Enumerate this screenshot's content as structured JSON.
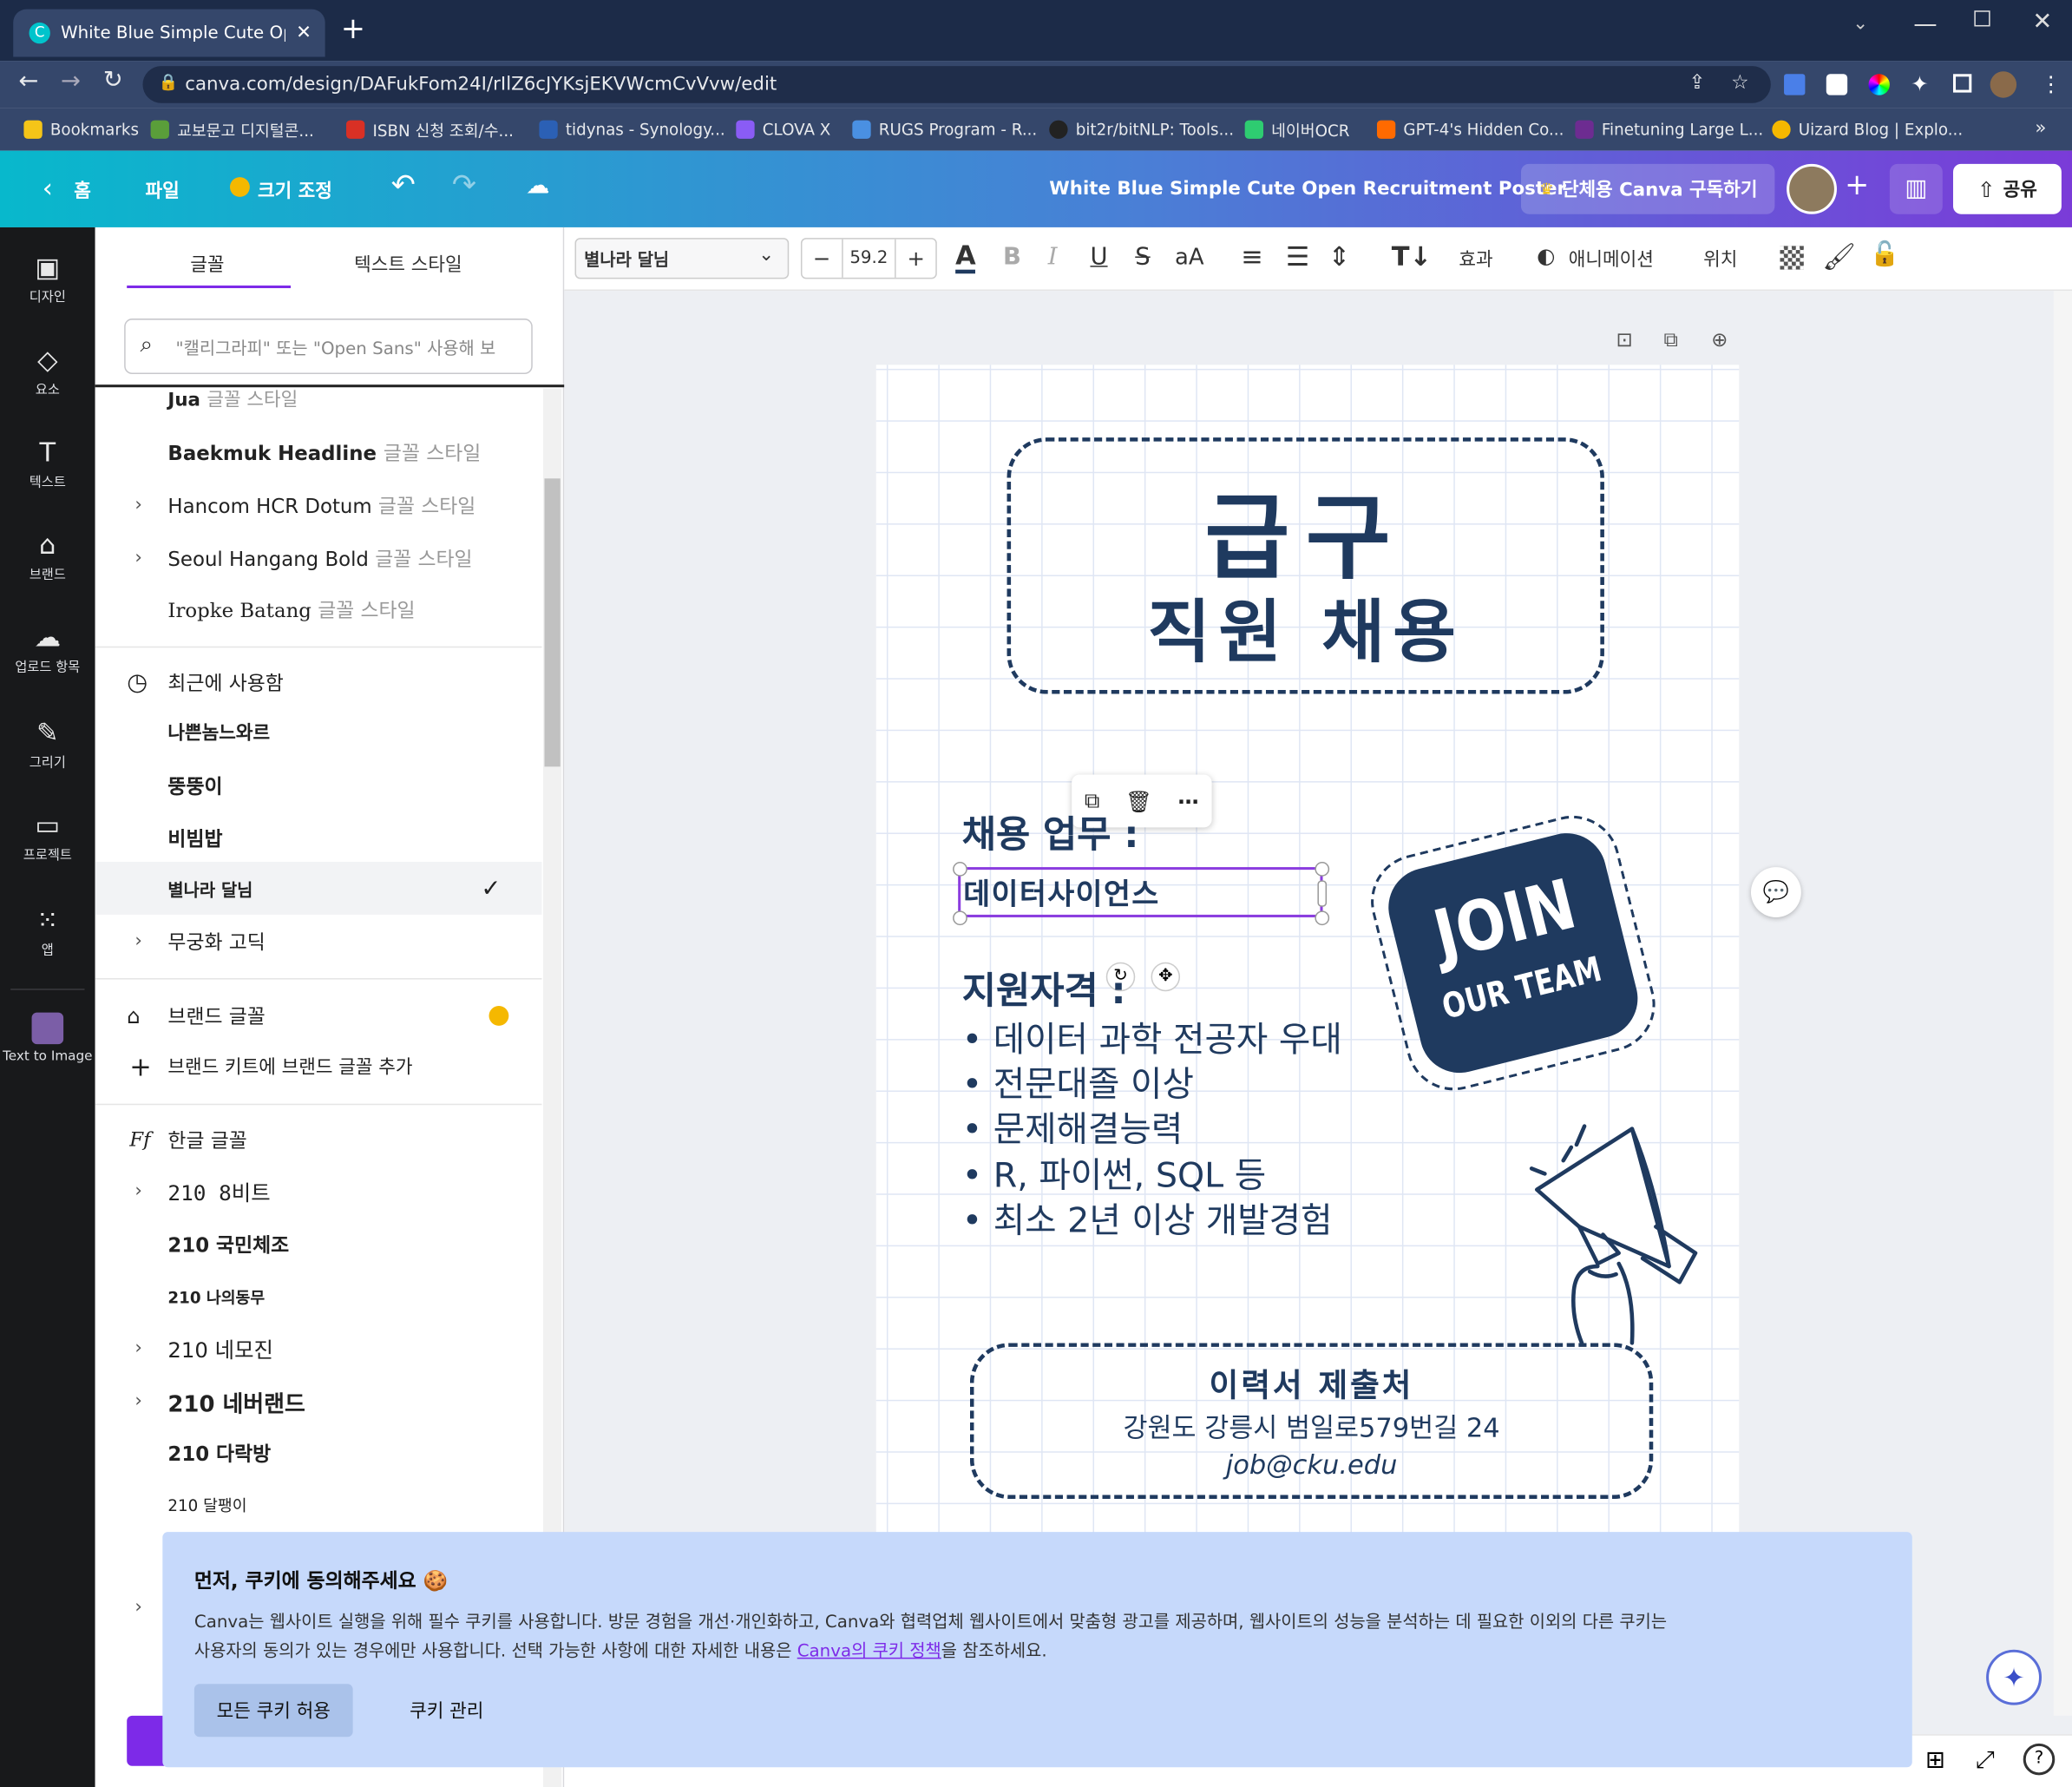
{
  "browser": {
    "tab_title": "White Blue Simple Cute Open R",
    "url": "canva.com/design/DAFukFom24I/rIlZ6cJYKsjEKVWcmCvVvw/edit",
    "bookmarks": [
      {
        "label": "Bookmarks",
        "color": "#f5c518"
      },
      {
        "label": "교보문고 디지털콘...",
        "color": "#5a9e3a"
      },
      {
        "label": "ISBN 신청 조회/수...",
        "color": "#d93025"
      },
      {
        "label": "tidynas - Synology...",
        "color": "#2b60b5"
      },
      {
        "label": "CLOVA X",
        "color": "#8a5cf5"
      },
      {
        "label": "RUGS Program - R...",
        "color": "#4a90e2"
      },
      {
        "label": "bit2r/bitNLP: Tools...",
        "color": "#222222"
      },
      {
        "label": "네이버OCR",
        "color": "#2ecc71"
      },
      {
        "label": "GPT-4's Hidden Co...",
        "color": "#ff6a00"
      },
      {
        "label": "Finetuning Large L...",
        "color": "#6d2c91"
      },
      {
        "label": "Uizard Blog | Explo...",
        "color": "#f5b800"
      }
    ]
  },
  "header": {
    "back": "홈",
    "file": "파일",
    "resize": "크기 조정",
    "title": "White Blue Simple Cute Open Recruitment Poster",
    "subscribe": "단체용 Canva 구독하기",
    "share": "공유"
  },
  "rail": [
    "디자인",
    "요소",
    "텍스트",
    "브랜드",
    "업로드 항목",
    "그리기",
    "프로젝트",
    "앱",
    "Text to Image"
  ],
  "panel": {
    "tab_font": "글꼴",
    "tab_style": "텍스트 스타일",
    "search_placeholder": "\"캘리그라피\" 또는 \"Open Sans\" 사용해 보",
    "top_fonts": [
      {
        "name": "Jua",
        "sub": "글꼴 스타일"
      },
      {
        "name": "Baekmuk Headline",
        "sub": "글꼴 스타일"
      },
      {
        "name": "Hancom HCR Dotum",
        "sub": "글꼴 스타일"
      },
      {
        "name": "Seoul Hangang Bold",
        "sub": "글꼴 스타일"
      },
      {
        "name": "Iropke Batang",
        "sub": "글꼴 스타일"
      }
    ],
    "recent_title": "최근에 사용함",
    "recent": [
      "나쁜놈느와르",
      "뚱뚱이",
      "비빔밥",
      "별나라 달님",
      "무궁화 고딕"
    ],
    "brand_title": "브랜드 글꼴",
    "brand_add": "브랜드 키트에 브랜드 글꼴 추가",
    "korean_title": "한글 글꼴",
    "korean": [
      "210 8비트",
      "210 국민체조",
      "210 나의동무",
      "210 네모진",
      "210 네버랜드",
      "210 다락방",
      "210 달팽이"
    ]
  },
  "toolbar": {
    "font": "별나라 달님",
    "size": "59.2",
    "effects": "효과",
    "animate": "애니메이션",
    "position": "위치"
  },
  "poster": {
    "title1": "급구",
    "title2": "직원 채용",
    "job_label": "채용 업무 :",
    "job_value": "데이터사이언스",
    "qual_label": "지원자격 :",
    "quals": [
      "데이터 과학 전공자 우대",
      "전문대졸 이상",
      "문제해결능력",
      "R, 파이썬, SQL 등",
      "최소 2년 이상 개발경험"
    ],
    "join1": "JOIN",
    "join2": "OUR TEAM",
    "submit_title": "이력서 제출처",
    "address": "강원도 강릉시 범일로579번길 24",
    "email": "job@cku.edu"
  },
  "cookie": {
    "title": "먼저, 쿠키에 동의해주세요 🍪",
    "body1": "Canva는 웹사이트 실행을 위해 필수 쿠키를 사용합니다. 방문 경험을 개선·개인화하고, Canva와 협력업체 웹사이트에서 맞춤형 광고를 제공하며, 웹사이트의 성능을 분석하는 데 필요한 이외의 다른 쿠키는",
    "body2_pre": "사용자의 동의가 있는 경우에만 사용합니다. 선택 가능한 사항에 대한 자세한 내용은 ",
    "link": "Canva의 쿠키 정책",
    "body2_post": "을 참조하세요.",
    "accept": "모든 쿠키 허용",
    "manage": "쿠키 관리"
  }
}
